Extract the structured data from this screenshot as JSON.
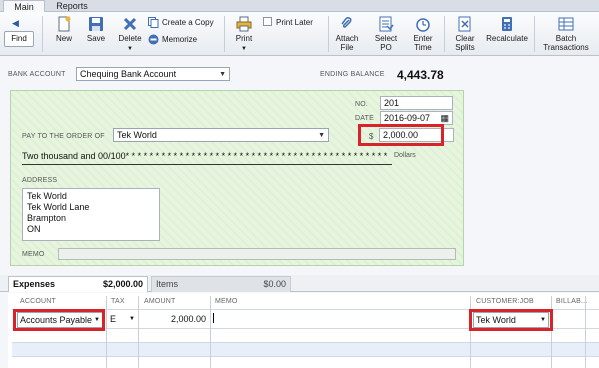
{
  "tabs": {
    "main": "Main",
    "reports": "Reports"
  },
  "toolbar": {
    "find": "Find",
    "new": "New",
    "save": "Save",
    "delete": "Delete",
    "create_copy": "Create a Copy",
    "memorize": "Memorize",
    "print": "Print",
    "print_later": "Print Later",
    "attach_file_1": "Attach",
    "attach_file_2": "File",
    "select_po_1": "Select",
    "select_po_2": "PO",
    "enter_time_1": "Enter",
    "enter_time_2": "Time",
    "clear_splits_1": "Clear",
    "clear_splits_2": "Splits",
    "recalculate": "Recalculate",
    "batch_1": "Batch",
    "batch_2": "Transactions"
  },
  "account": {
    "label": "BANK ACCOUNT",
    "value": "Chequing Bank Account",
    "ending_label": "ENDING BALANCE",
    "ending_value": "4,443.78"
  },
  "cheque": {
    "no_label": "NO.",
    "no_value": "201",
    "date_label": "DATE",
    "date_value": "2016-09-07",
    "pay_label": "PAY TO THE ORDER OF",
    "payee": "Tek World",
    "dollar_sign": "$",
    "amount": "2,000.00",
    "amount_words": "Two thousand  and 00/100* * * * * * * * * * * * * * * * * * * * * * * * * * * * * * * * * * * * * * * * * * * * * * * * * *",
    "dollars_label": "Dollars",
    "address_label": "ADDRESS",
    "address": [
      "Tek World",
      "Tek World Lane",
      "Brampton",
      "ON"
    ],
    "memo_label": "MEMO"
  },
  "detail_tabs": {
    "expenses_label": "Expenses",
    "expenses_amount": "$2,000.00",
    "items_label": "Items",
    "items_amount": "$0.00"
  },
  "grid": {
    "headers": {
      "account": "ACCOUNT",
      "tax": "TAX",
      "amount": "AMOUNT",
      "memo": "MEMO",
      "customer_job": "CUSTOMER:JOB",
      "billable": "BILLAB..."
    },
    "row1": {
      "account": "Accounts Payable",
      "tax": "E",
      "amount": "2,000.00",
      "memo": "",
      "customer_job": "Tek World"
    }
  },
  "colors": {
    "highlight": "#d8232a",
    "cheque_bg": "#e7f5df",
    "accent": "#2a5aa6"
  }
}
